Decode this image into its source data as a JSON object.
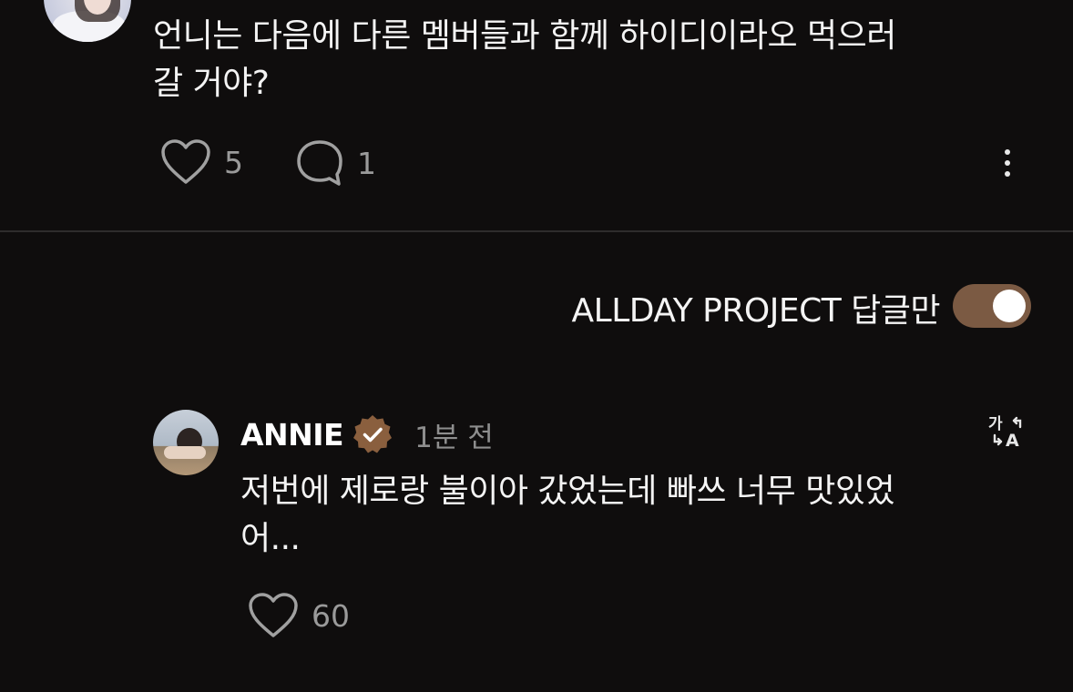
{
  "top_comment": {
    "text": "언니는 다음에 다른 멤버들과 함께 하이디이라오 먹으러\n갈 거야?",
    "like_count": "5",
    "reply_count": "1"
  },
  "filter": {
    "label": "ALLDAY PROJECT 답글만",
    "toggle_on": true,
    "toggle_color": "#7b5a43"
  },
  "reply": {
    "author": "ANNIE",
    "verified_badge": "verified-check-icon",
    "badge_color": "#8a5f3e",
    "time": "1분 전",
    "text": "저번에 제로랑 불이아 갔었는데 빠쓰 너무 맛있었\n어...",
    "like_count": "60"
  },
  "icons": {
    "like": "heart-outline-icon",
    "reply": "speech-bubble-icon",
    "more": "vertical-ellipsis-icon",
    "translate": "translate-icon"
  }
}
